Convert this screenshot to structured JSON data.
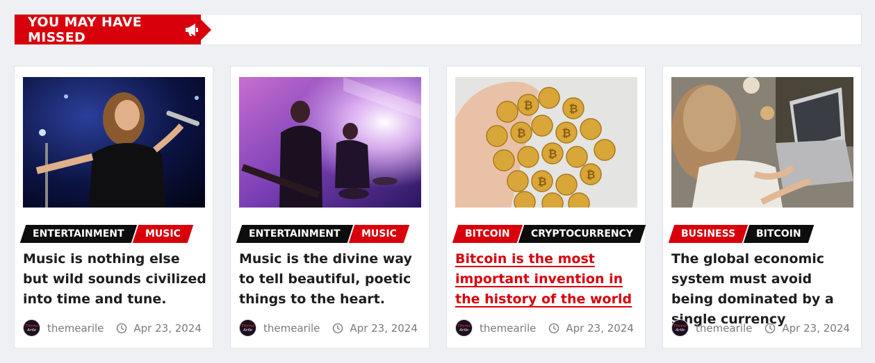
{
  "section": {
    "title": "YOU MAY HAVE MISSED",
    "icon": "megaphone-icon",
    "accent_color": "#d8000b"
  },
  "cards": [
    {
      "image_alt": "Singer performing with microphone on stage",
      "tags": [
        {
          "label": "ENTERTAINMENT",
          "color": "black"
        },
        {
          "label": "MUSIC",
          "color": "red"
        }
      ],
      "title": "Music is nothing else but wild sounds civilized into time and tune.",
      "author": "themearile",
      "date": "Apr 23, 2024"
    },
    {
      "image_alt": "Band playing guitar and drums under stage lights",
      "tags": [
        {
          "label": "ENTERTAINMENT",
          "color": "black"
        },
        {
          "label": "MUSIC",
          "color": "red"
        }
      ],
      "title": "Music is the divine way to tell beautiful, poetic things to the heart.",
      "author": "themearile",
      "date": "Apr 23, 2024"
    },
    {
      "image_alt": "Hand holding a pile of gold bitcoins",
      "tags": [
        {
          "label": "BITCOIN",
          "color": "red"
        },
        {
          "label": "CRYPTOCURRENCY",
          "color": "black"
        }
      ],
      "title": "Bitcoin is the most important invention in the history of the world",
      "author": "themearile",
      "date": "Apr 23, 2024",
      "active": true
    },
    {
      "image_alt": "Woman working on a laptop at a table",
      "tags": [
        {
          "label": "BUSINESS",
          "color": "red"
        },
        {
          "label": "BITCOIN",
          "color": "black"
        }
      ],
      "title": "The global economic system must avoid being dominated by a single currency",
      "author": "themearile",
      "date": "Apr 23, 2024"
    }
  ]
}
